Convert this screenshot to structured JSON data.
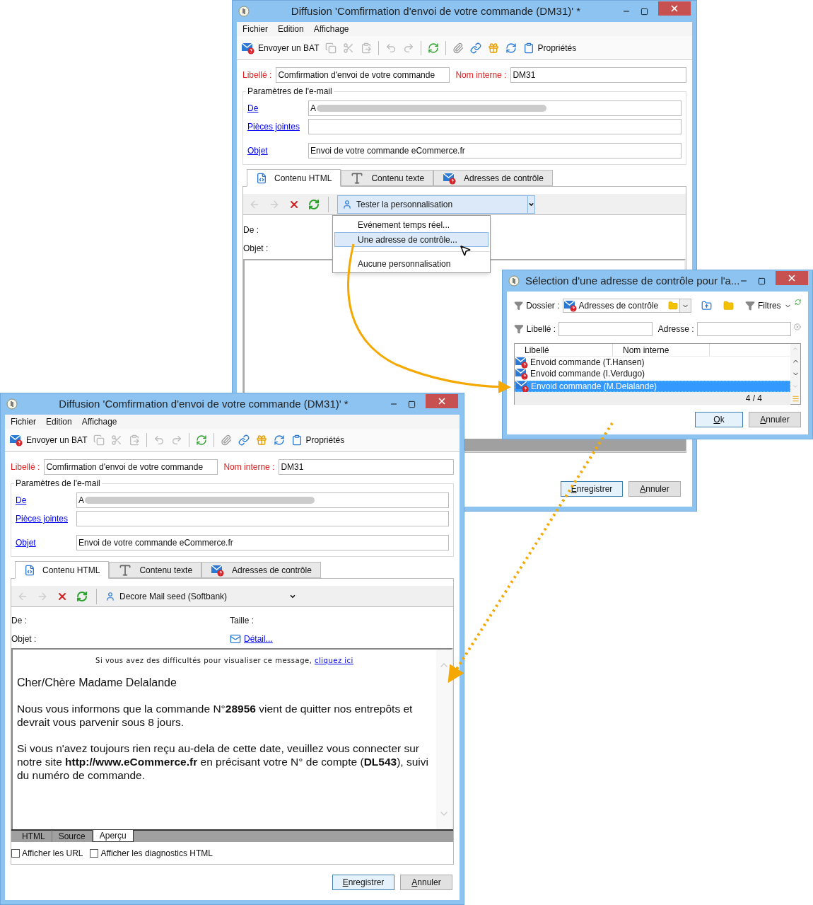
{
  "back_window": {
    "title": "Diffusion 'Comfirmation d'envoi de votre commande (DM31)' *",
    "menu": [
      "Fichier",
      "Edition",
      "Affichage"
    ],
    "toolbar": {
      "send_proof": "Envoyer un BAT",
      "properties": "Propriétés"
    },
    "label_field": {
      "label": "Libellé :",
      "value": "Comfirmation d'envoi de votre commande"
    },
    "internal_name": {
      "label": "Nom interne :",
      "value": "DM31"
    },
    "email_params": {
      "title": "Paramètres de l'e-mail",
      "from": {
        "label": "De",
        "value": "A"
      },
      "attachments": {
        "label": "Pièces jointes"
      },
      "subject": {
        "label": "Objet",
        "value": "Envoi de votre commande eCommerce.fr"
      }
    },
    "tabs": [
      {
        "label": "Contenu HTML",
        "selected": true
      },
      {
        "label": "Contenu texte",
        "selected": false
      },
      {
        "label": "Adresses de contrôle",
        "selected": false
      }
    ],
    "personalization": "Tester la personnalisation",
    "preview": {
      "from_label": "De :",
      "subject_label": "Objet :"
    },
    "dropdown_menu": [
      {
        "label": "Evénement temps réel...",
        "selected": false
      },
      {
        "label": "Une adresse de contrôle...",
        "selected": true
      },
      {
        "label": "Aucune personnalisation",
        "selected": false
      }
    ],
    "buttons": [
      "Enregistrer",
      "Annuler"
    ]
  },
  "dialog": {
    "title": "Sélection d'une adresse de contrôle pour l'a...",
    "folder": {
      "label": "Dossier :",
      "value": "Adresses de contrôle"
    },
    "filters": "Filtres",
    "label_filter": {
      "label": "Libellé :"
    },
    "address_filter": {
      "label": "Adresse :"
    },
    "columns": [
      "Libellé",
      "Nom interne"
    ],
    "rows": [
      {
        "label": "Envoid commande (T.Hansen)",
        "selected": false
      },
      {
        "label": "Envoid commande (I.Verdugo)",
        "selected": false
      },
      {
        "label": "Envoid commande (M.Delalande)",
        "selected": true
      }
    ],
    "count": "4 / 4",
    "buttons": [
      "Ok",
      "Annuler"
    ]
  },
  "front_window": {
    "title": "Diffusion 'Comfirmation d'envoi de votre commande (DM31)' *",
    "menu": [
      "Fichier",
      "Edition",
      "Affichage"
    ],
    "toolbar": {
      "send_proof": "Envoyer un BAT",
      "properties": "Propriétés"
    },
    "label_field": {
      "label": "Libellé :",
      "value": "Comfirmation d'envoi de votre commande"
    },
    "internal_name": {
      "label": "Nom interne :",
      "value": "DM31"
    },
    "email_params": {
      "title": "Paramètres de l'e-mail",
      "from": {
        "label": "De",
        "value": "A"
      },
      "attachments": {
        "label": "Pièces jointes"
      },
      "subject": {
        "label": "Objet",
        "value": "Envoi de votre commande eCommerce.fr"
      }
    },
    "tabs": [
      {
        "label": "Contenu HTML",
        "selected": true
      },
      {
        "label": "Contenu texte",
        "selected": false
      },
      {
        "label": "Adresses de contrôle",
        "selected": false
      }
    ],
    "personalization": "Decore Mail seed (Softbank)",
    "preview": {
      "from_label": "De :",
      "size_label": "Taille :",
      "subject_label": "Objet :",
      "detail_link": "Détail..."
    },
    "email": {
      "notice": "Si vous avez des difficultés pour visualiser ce message,",
      "notice_link": "cliquez ici",
      "greeting": "Cher/Chère Madame Delalande",
      "paragraphs": [
        "Nous vous informons que la commande N°**28956** vient de quitter nos entrepôts et devrait vous parvenir sous 8 jours.",
        "Si vous n'avez toujours rien reçu au-dela de cette date, veuillez vous connecter sur notre site **http://www.eCommerce.fr** en précisant votre N° de compte (**DL543**), suivi du numéro de commande."
      ]
    },
    "view_tabs": [
      {
        "label": "HTML",
        "selected": false
      },
      {
        "label": "Source",
        "selected": false
      },
      {
        "label": "Aperçu",
        "selected": true
      }
    ],
    "options": [
      {
        "label": "Afficher les URL",
        "checked": false
      },
      {
        "label": "Afficher les diagnostics HTML",
        "checked": false
      }
    ],
    "buttons": [
      "Enregistrer",
      "Annuler"
    ]
  }
}
